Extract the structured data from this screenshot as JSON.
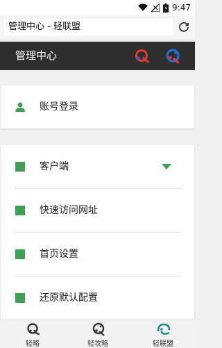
{
  "status_bar": {
    "time": "9:47",
    "icons": [
      "wifi-icon",
      "signal-icon",
      "battery-icon"
    ]
  },
  "url_bar": {
    "value": "管理中心 - 轻联盟",
    "refresh_icon": "refresh-icon"
  },
  "header": {
    "title": "管理中心",
    "logos": [
      "qinglue-logo-icon",
      "qinggonglue-logo-icon"
    ]
  },
  "account": {
    "label": "账号登录",
    "icon": "user-icon"
  },
  "menu": {
    "items": [
      {
        "label": "客户端",
        "has_dropdown": true
      },
      {
        "label": "快速访问网址"
      },
      {
        "label": "首页设置"
      },
      {
        "label": "还原默认配置"
      }
    ]
  },
  "bottom_nav": {
    "items": [
      {
        "label": "轻略",
        "icon": "qinglue-icon"
      },
      {
        "label": "轻攻略",
        "icon": "qinggonglue-icon"
      },
      {
        "label": "轻联盟",
        "icon": "qinglianmeng-icon"
      }
    ]
  },
  "colors": {
    "accent_green": "#3ea052",
    "header_bg": "#2e2e2e",
    "logo_red": "#e53935",
    "logo_blue": "#1e6fd9",
    "nav_teal": "#1f8f8a"
  }
}
